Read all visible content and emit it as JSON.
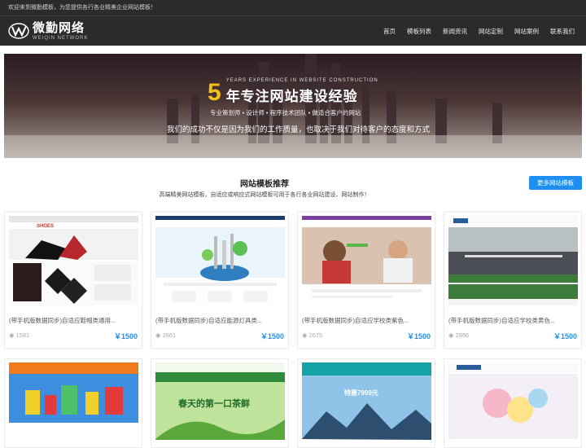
{
  "header": {
    "welcome": "欢迎来到微勤模板，为您提供各行各业精美企业网站模板！",
    "logo_cn": "微勤网络",
    "logo_en": "WEIQIN NETWORK",
    "nav": [
      "首页",
      "模板列表",
      "新闻资讯",
      "网站定制",
      "网站案例",
      "联系我们"
    ]
  },
  "banner": {
    "big_number": "5",
    "en_text": "YEARS EXPERIENCE IN WEBSITE CONSTRUCTION",
    "cn_title": "年专注网站建设经验",
    "sub": "专业策划师 • 设计师 • 程序技术团队 • 做适合客户的网站",
    "line": "我们的成功不仅是因为我们的工作质量，也取决于我们对待客户的态度和方式"
  },
  "section": {
    "title": "网站模板推荐",
    "desc": "高端精美网站模板，自适应或响应式网站模板可用于各行各业网站建设、网站制作！",
    "more_btn": "更多网站模板"
  },
  "cards": [
    {
      "title": "(带手机版数据同步)自适应鞋帽类通用...",
      "views": "1581",
      "price": "￥1500",
      "logo": "SHOES"
    },
    {
      "title": "(带手机版数据同步)自适应能源灯具类...",
      "views": "2661",
      "price": "￥1500"
    },
    {
      "title": "(带手机版数据同步)自适应学校类紫色...",
      "views": "2675",
      "price": "￥1500"
    },
    {
      "title": "(带手机版数据同步)自适应学校类黄色...",
      "views": "2896",
      "price": "￥1500"
    }
  ],
  "row2": [
    {
      "label": ""
    },
    {
      "label": "春天的第一口茶鲜"
    },
    {
      "label": "特惠7999元"
    },
    {
      "label": ""
    }
  ],
  "colors": {
    "accent": "#1e8ff0",
    "header": "#2b2b2b",
    "gold": "#f2c11a"
  }
}
